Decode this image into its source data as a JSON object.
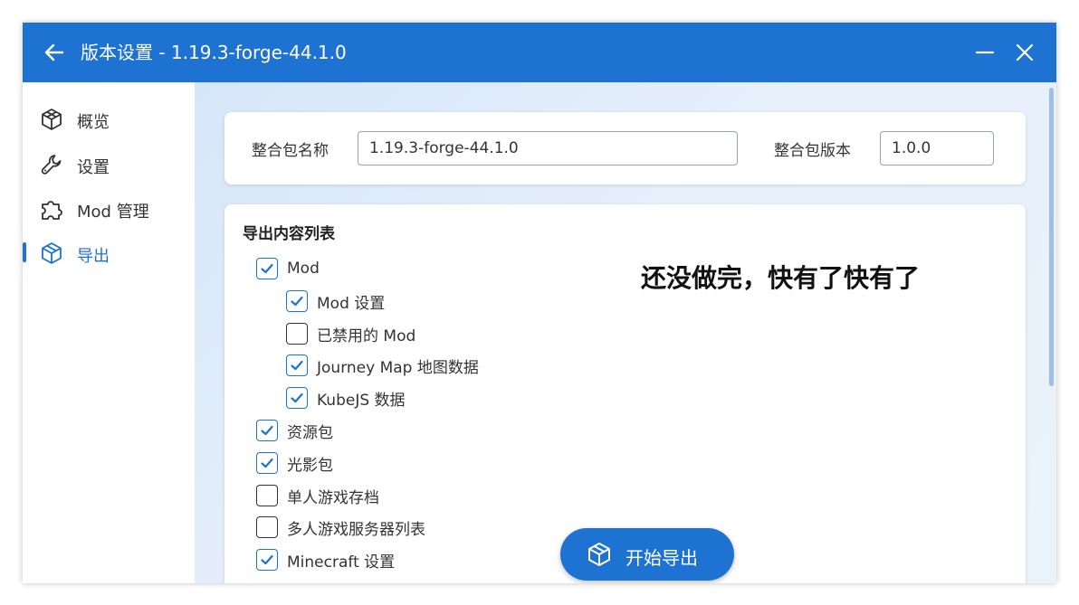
{
  "window": {
    "title": "版本设置 - 1.19.3-forge-44.1.0"
  },
  "sidebar": {
    "items": [
      {
        "label": "概览",
        "icon": "cube-outline-icon"
      },
      {
        "label": "设置",
        "icon": "wrench-icon"
      },
      {
        "label": "Mod 管理",
        "icon": "puzzle-icon"
      },
      {
        "label": "导出",
        "icon": "package-icon",
        "active": true
      }
    ]
  },
  "modpack": {
    "name_label": "整合包名称",
    "name_value": "1.19.3-forge-44.1.0",
    "version_label": "整合包版本",
    "version_value": "1.0.0"
  },
  "export_list": {
    "title": "导出内容列表",
    "items": [
      {
        "label": "Mod",
        "checked": true,
        "level": 0
      },
      {
        "label": "Mod 设置",
        "checked": true,
        "level": 1
      },
      {
        "label": "已禁用的 Mod",
        "checked": false,
        "level": 1
      },
      {
        "label": "Journey Map 地图数据",
        "checked": true,
        "level": 1
      },
      {
        "label": "KubeJS 数据",
        "checked": true,
        "level": 1
      },
      {
        "label": "资源包",
        "checked": true,
        "level": 0
      },
      {
        "label": "光影包",
        "checked": true,
        "level": 0
      },
      {
        "label": "单人游戏存档",
        "checked": false,
        "level": 0
      },
      {
        "label": "多人游戏服务器列表",
        "checked": false,
        "level": 0
      },
      {
        "label": "Minecraft 设置",
        "checked": true,
        "level": 0
      }
    ]
  },
  "note": "还没做完，快有了快有了",
  "export_button": {
    "label": "开始导出"
  },
  "colors": {
    "accent": "#1e73d2",
    "text": "#333333"
  }
}
